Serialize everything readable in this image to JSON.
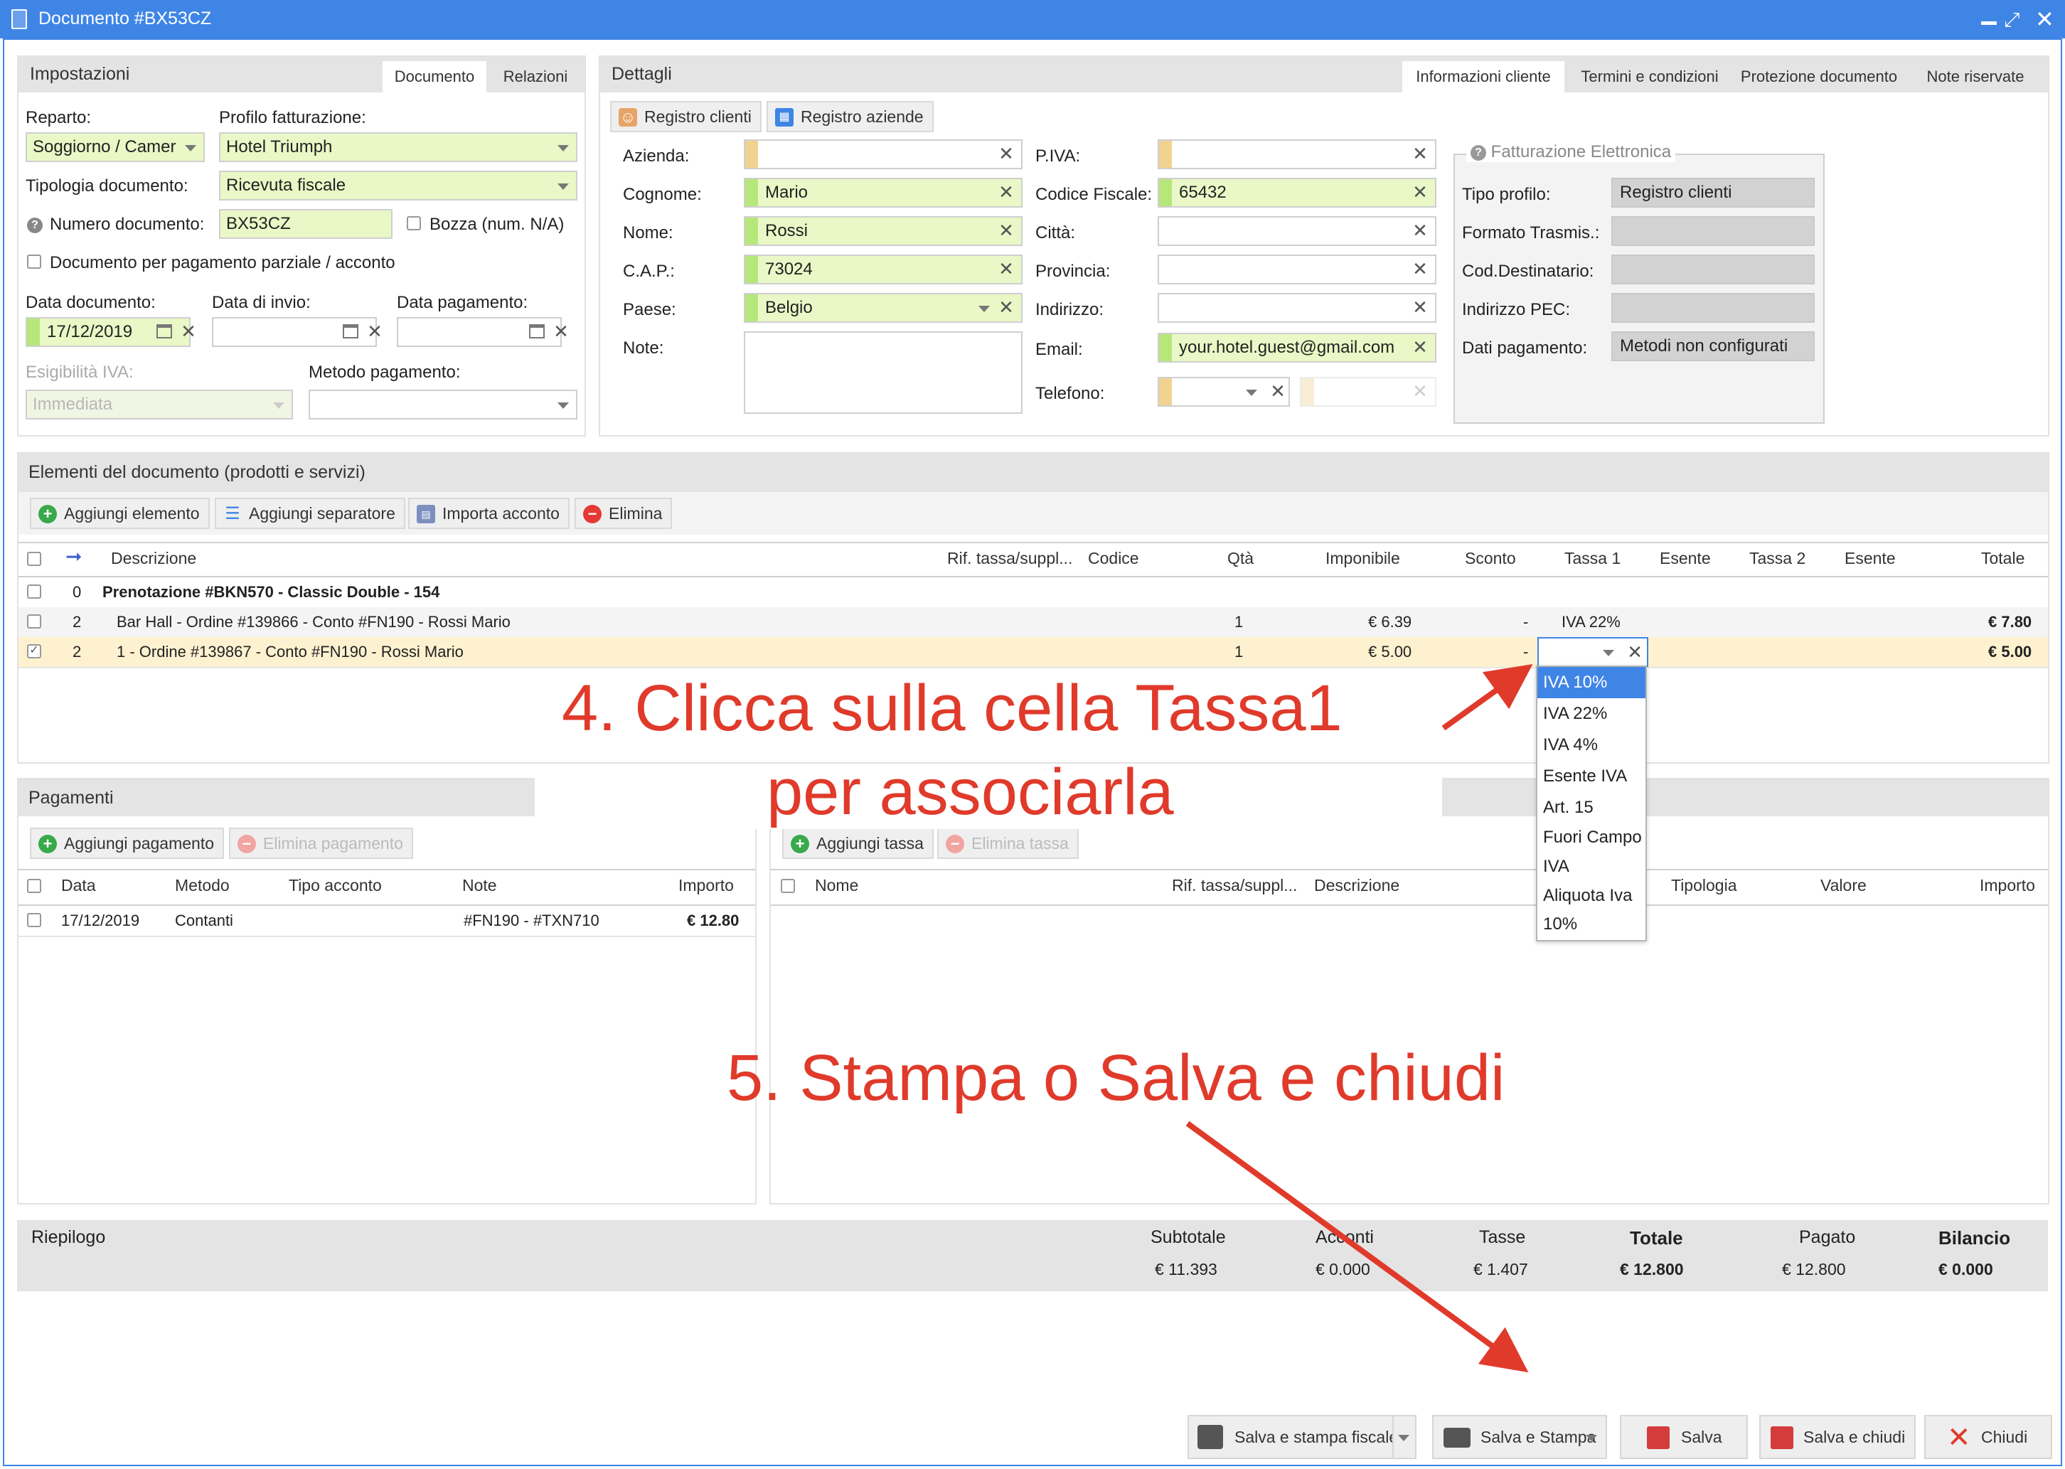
{
  "window": {
    "title": "Documento #BX53CZ"
  },
  "impostazioni": {
    "title": "Impostazioni",
    "tabs": [
      "Documento",
      "Relazioni"
    ],
    "reparto_label": "Reparto:",
    "reparto_value": "Soggiorno / Camer",
    "profilo_label": "Profilo fatturazione:",
    "profilo_value": "Hotel Triumph",
    "tipologia_label": "Tipologia documento:",
    "tipologia_value": "Ricevuta fiscale",
    "numero_label": "Numero documento:",
    "numero_value": "BX53CZ",
    "bozza_label": "Bozza (num. N/A)",
    "parziale_label": "Documento per pagamento parziale / acconto",
    "data_doc_label": "Data documento:",
    "data_doc_value": "17/12/2019",
    "data_invio_label": "Data di invio:",
    "data_pag_label": "Data pagamento:",
    "esig_label": "Esigibilità IVA:",
    "esig_value": "Immediata",
    "metodo_label": "Metodo pagamento:"
  },
  "dettagli": {
    "title": "Dettagli",
    "tabs": [
      "Informazioni cliente",
      "Termini e condizioni",
      "Protezione documento",
      "Note riservate"
    ],
    "btn_clienti": "Registro clienti",
    "btn_aziende": "Registro aziende",
    "azienda_label": "Azienda:",
    "cognome_label": "Cognome:",
    "cognome_value": "Mario",
    "nome_label": "Nome:",
    "nome_value": "Rossi",
    "cap_label": "C.A.P.:",
    "cap_value": "73024",
    "paese_label": "Paese:",
    "paese_value": "Belgio",
    "note_label": "Note:",
    "piva_label": "P.IVA:",
    "cf_label": "Codice Fiscale:",
    "cf_value": "65432",
    "citta_label": "Città:",
    "provincia_label": "Provincia:",
    "indirizzo_label": "Indirizzo:",
    "email_label": "Email:",
    "email_value": "your.hotel.guest@gmail.com",
    "telefono_label": "Telefono:"
  },
  "fe": {
    "title": "Fatturazione Elettronica",
    "tipo_label": "Tipo profilo:",
    "tipo_value": "Registro clienti",
    "formato_label": "Formato Trasmis.:",
    "cod_label": "Cod.Destinatario:",
    "pec_label": "Indirizzo PEC:",
    "dati_label": "Dati pagamento:",
    "dati_value": "Metodi non configurati"
  },
  "elementi": {
    "title": "Elementi del documento (prodotti e servizi)",
    "btn_add": "Aggiungi elemento",
    "btn_sep": "Aggiungi separatore",
    "btn_imp": "Importa acconto",
    "btn_del": "Elimina",
    "headers": {
      "desc": "Descrizione",
      "rif": "Rif. tassa/suppl...",
      "codice": "Codice",
      "qta": "Qtà",
      "imponibile": "Imponibile",
      "sconto": "Sconto",
      "tassa1": "Tassa 1",
      "esente1": "Esente",
      "tassa2": "Tassa 2",
      "esente2": "Esente",
      "totale": "Totale"
    },
    "rows": [
      {
        "idx": "0",
        "desc": "Prenotazione #BKN570 - Classic Double - 154",
        "qta": "",
        "imponibile": "",
        "sconto": "",
        "tassa1": "",
        "totale": ""
      },
      {
        "idx": "2",
        "desc": "Bar Hall - Ordine #139866 - Conto #FN190 - Rossi Mario",
        "qta": "1",
        "imponibile": "€ 6.39",
        "sconto": "-",
        "tassa1": "IVA 22%",
        "totale": "€ 7.80"
      },
      {
        "idx": "2",
        "desc": "1 - Ordine #139867 - Conto #FN190 - Rossi Mario",
        "qta": "1",
        "imponibile": "€ 5.00",
        "sconto": "-",
        "tassa1": "",
        "totale": "€ 5.00"
      }
    ],
    "dropdown": [
      "IVA 10%",
      "IVA 22%",
      "IVA 4%",
      "Esente IVA",
      "Art. 15",
      "Fuori Campo",
      "IVA",
      "Aliquota Iva",
      "10%"
    ]
  },
  "pagamenti": {
    "title": "Pagamenti",
    "btn_add": "Aggiungi pagamento",
    "btn_del": "Elimina pagamento",
    "headers": {
      "data": "Data",
      "metodo": "Metodo",
      "tipo": "Tipo acconto",
      "note": "Note",
      "importo": "Importo"
    },
    "rows": [
      {
        "data": "17/12/2019",
        "metodo": "Contanti",
        "tipo": "",
        "note": "#FN190 - #TXN710",
        "importo": "€ 12.80"
      }
    ]
  },
  "tasse": {
    "btn_add": "Aggiungi tassa",
    "btn_del": "Elimina tassa",
    "headers": {
      "nome": "Nome",
      "rif": "Rif. tassa/suppl...",
      "desc": "Descrizione",
      "tipologia": "Tipologia",
      "valore": "Valore",
      "importo": "Importo"
    }
  },
  "riepilogo": {
    "title": "Riepilogo",
    "subtotale_label": "Subtotale",
    "subtotale": "€ 11.393",
    "acconti_label": "Acconti",
    "acconti": "€ 0.000",
    "tasse_label": "Tasse",
    "tasse": "€ 1.407",
    "totale_label": "Totale",
    "totale": "€ 12.800",
    "pagato_label": "Pagato",
    "pagato": "€ 12.800",
    "bilancio_label": "Bilancio",
    "bilancio": "€ 0.000"
  },
  "annotations": {
    "step4_line1": "4. Clicca sulla cella Tassa1",
    "step4_line2": "per associarla",
    "step5": "5. Stampa o Salva e chiudi"
  },
  "footer": {
    "fiscale": "Salva e stampa fiscale",
    "stampa": "Salva e Stampa",
    "salva": "Salva",
    "salva_chiudi": "Salva e chiudi",
    "chiudi": "Chiudi"
  },
  "colors": {
    "titlebar": "#3f85e6",
    "annotation": "#e03a2b",
    "selected_row": "#fdf1cf",
    "dropdown_selected": "#3f85e6"
  }
}
